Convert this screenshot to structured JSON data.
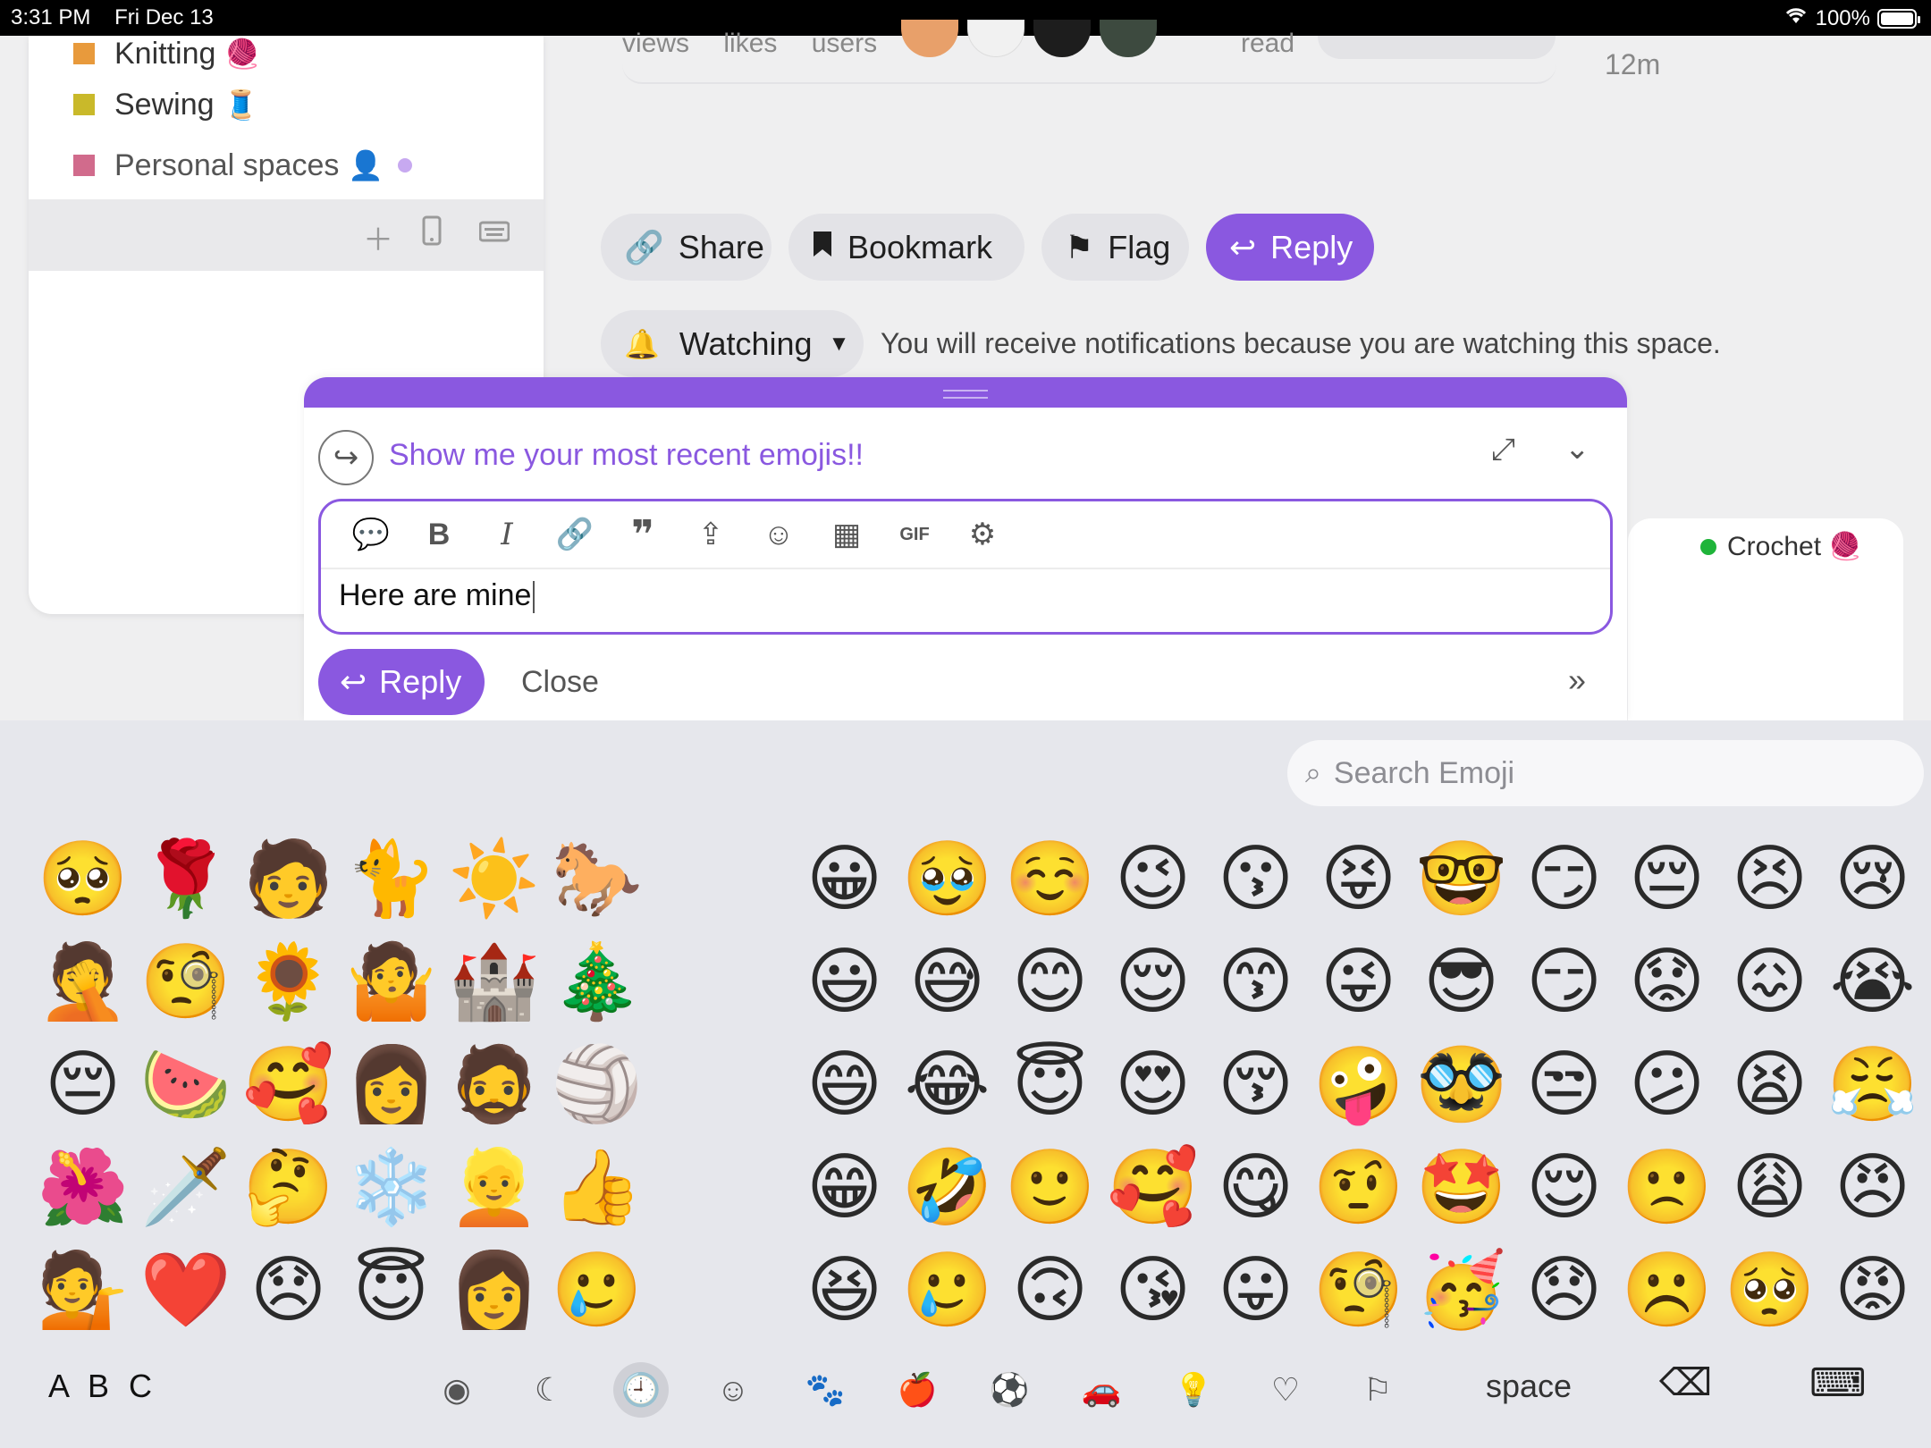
{
  "status": {
    "time": "3:31 PM",
    "date": "Fri Dec 13",
    "battery": "100%"
  },
  "sidebar": {
    "items": [
      {
        "label": "Knitting",
        "emoji": "🧶",
        "color": "#e89a3c"
      },
      {
        "label": "Sewing",
        "emoji": "🧵",
        "color": "#c9b92a"
      },
      {
        "label": "Personal spaces",
        "emoji": "👤",
        "color": "#d16b8c"
      }
    ]
  },
  "topic_stats": {
    "views": "views",
    "likes": "likes",
    "users": "users",
    "read": "read",
    "time": "12m"
  },
  "actions": {
    "share": "Share",
    "bookmark": "Bookmark",
    "flag": "Flag",
    "reply": "Reply"
  },
  "notifications": {
    "level": "Watching",
    "note": "You will receive notifications because you are watching this space."
  },
  "side_card": {
    "category": "Crochet",
    "emoji": "🧶"
  },
  "composer": {
    "topic_title": "Show me your most recent emojis!!",
    "body_text": "Here are mine",
    "reply_label": "Reply",
    "close_label": "Close"
  },
  "keyboard": {
    "search_placeholder": "Search Emoji",
    "abc_label": "A B C",
    "space_label": "space",
    "recent_emojis": [
      "🥺",
      "🤦",
      "😔",
      "🌺",
      "💁",
      "🌹",
      "🧐",
      "🍉",
      "🗡️",
      "❤️",
      "🧑",
      "🌻",
      "🥰",
      "🤔",
      "😞",
      "🐈",
      "🤷",
      "👩",
      "❄️",
      "😇",
      "☀️",
      "🏰",
      "🧔",
      "👱",
      "👩",
      "🐎",
      "🎄",
      "🏐",
      "👍",
      "🥲"
    ],
    "smileys": [
      "😀",
      "😃",
      "😄",
      "😁",
      "😆",
      "🥹",
      "😅",
      "😂",
      "🤣",
      "🥲",
      "☺️",
      "😊",
      "😇",
      "🙂",
      "🙃",
      "😉",
      "😌",
      "😍",
      "🥰",
      "😘",
      "😗",
      "😙",
      "😚",
      "😋",
      "😛",
      "😝",
      "😜",
      "🤪",
      "🤨",
      "🧐",
      "🤓",
      "😎",
      "🥸",
      "🤩",
      "🥳",
      "😏",
      "😏",
      "😒",
      "😌",
      "😞",
      "😔",
      "😟",
      "😕",
      "🙁",
      "☹️",
      "😣",
      "😖",
      "😫",
      "😩",
      "🥺",
      "😢",
      "😭",
      "😤",
      "😠",
      "😡"
    ],
    "categories": [
      "memoji-icon",
      "moon-icon",
      "clock-icon",
      "smiley-icon",
      "dog-icon",
      "apple-icon",
      "ball-icon",
      "car-icon",
      "bulb-icon",
      "heart-icon",
      "flag-icon"
    ],
    "colors": {
      "accent": "#8a58e0"
    }
  }
}
